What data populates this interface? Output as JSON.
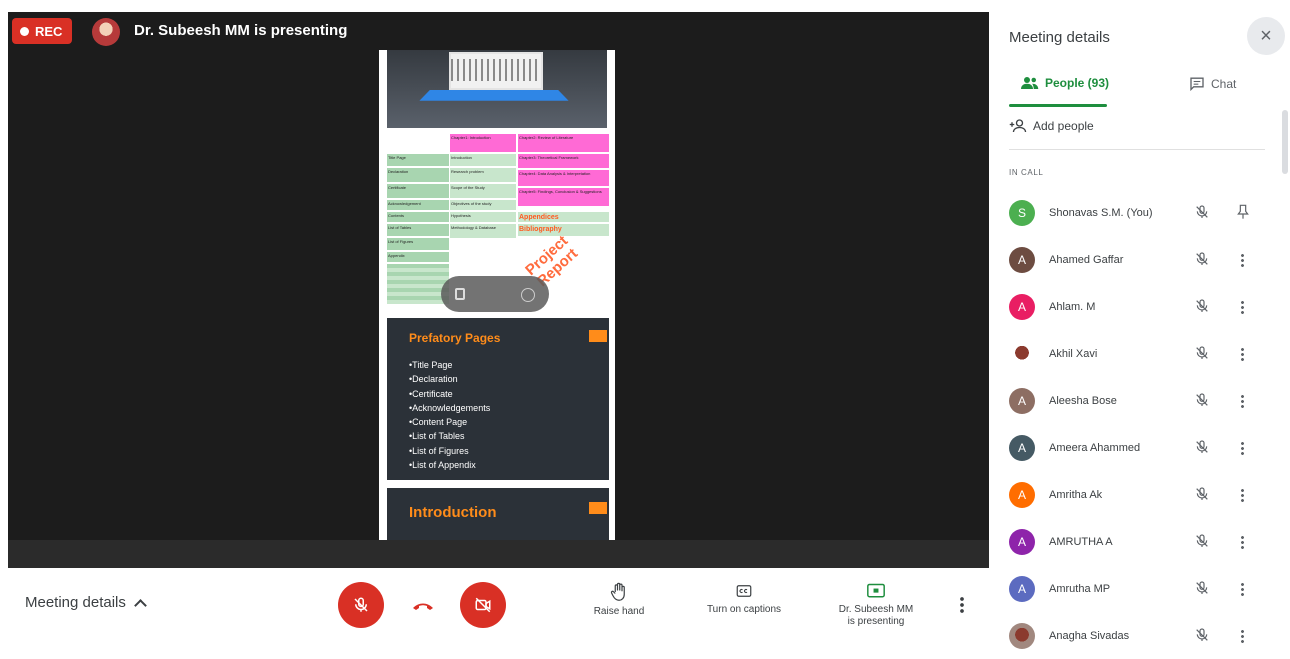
{
  "call": {
    "rec_label": "REC",
    "presenter_label": "Dr. Subeesh MM is presenting"
  },
  "slide": {
    "table": [
      {
        "text": "Chapter1: Introduction",
        "cls": "pk"
      },
      {
        "text": "Chapter2: Review of Literature",
        "cls": "pk"
      },
      {
        "text": "Title Page",
        "cls": "g1"
      },
      {
        "text": "Introduction",
        "cls": "g2"
      },
      {
        "text": "Chapter3: Theoretical Framework",
        "cls": "pk"
      },
      {
        "text": "Declaration",
        "cls": "g1"
      },
      {
        "text": "Research problem",
        "cls": "g2"
      },
      {
        "text": "Chapter4: Data Analysis & Interpretation",
        "cls": "pk"
      },
      {
        "text": "Certificate",
        "cls": "g1"
      },
      {
        "text": "Scope of the Study",
        "cls": "g2"
      },
      {
        "text": "Chapter5: Findings, Conclusion & Suggestions",
        "cls": "pk"
      },
      {
        "text": "Acknowledgement",
        "cls": "g1"
      },
      {
        "text": "Objectives of the study",
        "cls": "g2"
      },
      {
        "text": "Contents",
        "cls": "g1"
      },
      {
        "text": "Hypothesis",
        "cls": "g2"
      },
      {
        "text": "Appendices",
        "cls": "g2"
      },
      {
        "text": "List of Tables",
        "cls": "g1"
      },
      {
        "text": "Methodology & Database",
        "cls": "g2"
      },
      {
        "text": "Bibliography",
        "cls": "g2"
      },
      {
        "text": "List of Figures",
        "cls": "g1"
      },
      {
        "text": "Appendix",
        "cls": "g1"
      }
    ],
    "stamp_line1": "Project",
    "stamp_line2": "Report",
    "panel1_title": "Prefatory Pages",
    "panel1_items": [
      "•Title Page",
      "•Declaration",
      "•Certificate",
      "•Acknowledgements",
      "•Content Page",
      "•List of Tables",
      "•List of Figures",
      "•List of Appendix"
    ],
    "panel2_title": "Introduction"
  },
  "bottombar": {
    "meeting_details_label": "Meeting details",
    "raise_hand_label": "Raise hand",
    "captions_label": "Turn on captions",
    "present_line1": "Dr. Subeesh MM",
    "present_line2": "is presenting"
  },
  "side": {
    "title": "Meeting details",
    "close_glyph": "×",
    "tab_people": "People (93)",
    "tab_chat": "Chat",
    "add_people": "Add people",
    "in_call_label": "IN CALL",
    "people": [
      {
        "initial": "S",
        "name": "Shonavas S.M. (You)",
        "color": "#4caf50",
        "you": true
      },
      {
        "initial": "A",
        "name": "Ahamed Gaffar",
        "color": "#6d4c41"
      },
      {
        "initial": "A",
        "name": "Ahlam. M",
        "color": "#e91e63"
      },
      {
        "initial": "",
        "name": "Akhil Xavi",
        "color": "#ffffff",
        "photo": true
      },
      {
        "initial": "A",
        "name": "Aleesha Bose",
        "color": "#8d6e63"
      },
      {
        "initial": "A",
        "name": "Ameera Ahammed",
        "color": "#455a64"
      },
      {
        "initial": "A",
        "name": "Amritha Ak",
        "color": "#ff6d00"
      },
      {
        "initial": "A",
        "name": "AMRUTHA A",
        "color": "#8e24aa"
      },
      {
        "initial": "A",
        "name": "Amrutha MP",
        "color": "#5c6bc0"
      },
      {
        "initial": "",
        "name": "Anagha Sivadas",
        "color": "#a1887f",
        "photo": true
      }
    ]
  }
}
